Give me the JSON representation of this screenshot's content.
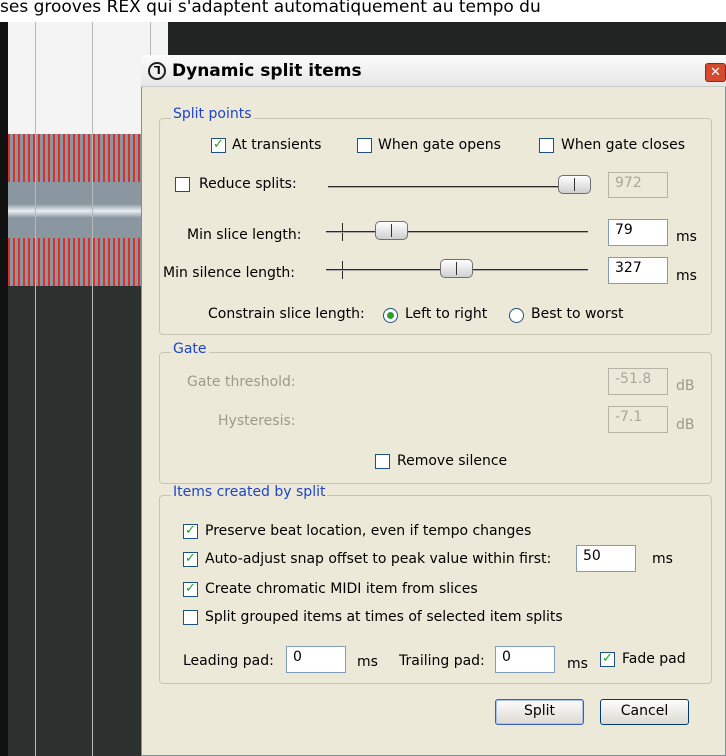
{
  "background": {
    "caption_text": "ses grooves REX qui s'adaptent automatiquement au tempo du"
  },
  "dialog": {
    "title": "Dynamic split items",
    "close_glyph": "✕",
    "split_points": {
      "group_label": "Split points",
      "at_transients": {
        "label": "At transients",
        "checked": true
      },
      "when_gate_opens": {
        "label": "When gate opens",
        "checked": false
      },
      "when_gate_closes": {
        "label": "When gate closes",
        "checked": false
      },
      "reduce_splits": {
        "label": "Reduce splits:",
        "checked": false,
        "value": "972",
        "slider_fraction": 0.98
      },
      "min_slice_length": {
        "label": "Min slice length:",
        "value": "79",
        "unit": "ms",
        "slider_fraction": 0.26
      },
      "min_silence_length": {
        "label": "Min silence length:",
        "value": "327",
        "unit": "ms",
        "slider_fraction": 0.5
      },
      "constrain": {
        "label": "Constrain slice length:",
        "options": [
          "Left to right",
          "Best to worst"
        ],
        "selected": "Left to right"
      }
    },
    "gate": {
      "group_label": "Gate",
      "threshold": {
        "label": "Gate threshold:",
        "value": "-51.8",
        "unit": "dB"
      },
      "hysteresis": {
        "label": "Hysteresis:",
        "value": "-7.1",
        "unit": "dB"
      },
      "remove_silence": {
        "label": "Remove silence",
        "checked": false
      }
    },
    "items_created": {
      "group_label": "Items created by split",
      "preserve_beat": {
        "label": "Preserve beat location, even if tempo changes",
        "checked": true
      },
      "auto_adjust": {
        "label": "Auto-adjust snap offset to peak value within first:",
        "checked": true,
        "value": "50",
        "unit": "ms"
      },
      "create_midi": {
        "label": "Create chromatic MIDI item from slices",
        "checked": true
      },
      "split_grouped": {
        "label": "Split grouped items at times of selected item splits",
        "checked": false
      },
      "leading_pad": {
        "label": "Leading pad:",
        "value": "0",
        "unit": "ms"
      },
      "trailing_pad": {
        "label": "Trailing pad:",
        "value": "0",
        "unit": "ms"
      },
      "fade_pad": {
        "label": "Fade pad",
        "checked": true
      }
    },
    "buttons": {
      "split": "Split",
      "cancel": "Cancel"
    }
  },
  "colors": {
    "accent": "#1f44c7",
    "check": "#21a121",
    "close": "#d44a2f"
  },
  "icons": {
    "title": "reaper-logo-icon",
    "close": "close-icon"
  }
}
